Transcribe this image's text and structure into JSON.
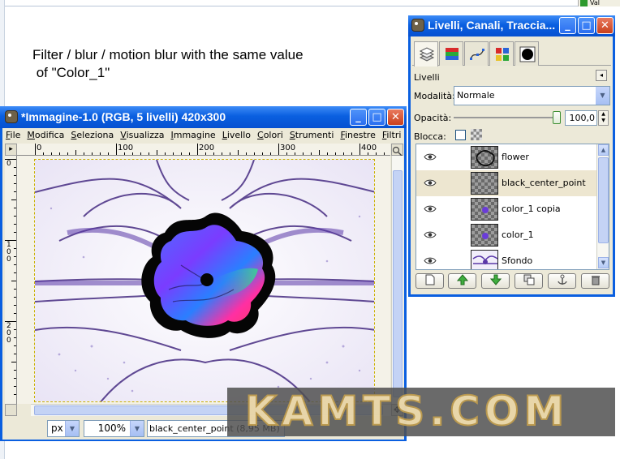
{
  "corner": {
    "label": "Val"
  },
  "instruction": {
    "line1": "Filter / blur / motion blur with the same value",
    "line2": " of \"Color_1\""
  },
  "image_window": {
    "title": "*Immagine-1.0 (RGB, 5 livelli) 420x300",
    "menu": [
      "File",
      "Modifica",
      "Seleziona",
      "Visualizza",
      "Immagine",
      "Livello",
      "Colori",
      "Strumenti",
      "Finestre",
      "Filtri"
    ],
    "ruler_h_labels": [
      "0",
      "100",
      "200",
      "300",
      "400"
    ],
    "ruler_v_labels": [
      "0",
      "1\n0\n0",
      "2\n0\n0"
    ],
    "unit": "px",
    "zoom": "100%",
    "status": "black_center_point (8,95 MB)"
  },
  "layers_window": {
    "title": "Livelli, Canali, Traccia...",
    "section_label": "Livelli",
    "mode_label": "Modalità:",
    "mode_value": "Normale",
    "opacity_label": "Opacità:",
    "opacity_value": "100,0",
    "lock_label": "Blocca:",
    "layers": [
      {
        "name": "flower",
        "visible": true,
        "selected": false
      },
      {
        "name": "black_center_point",
        "visible": true,
        "selected": true
      },
      {
        "name": "color_1 copia",
        "visible": true,
        "selected": false
      },
      {
        "name": "color_1",
        "visible": true,
        "selected": false
      },
      {
        "name": "Sfondo",
        "visible": true,
        "selected": false
      }
    ]
  },
  "watermark": {
    "text": "KAMTS.COM"
  },
  "colors": {
    "xp_blue": "#0a5fe0",
    "panel": "#ece9d8",
    "purple": "#4b2c8f",
    "selected_row": "#ede6d0"
  }
}
